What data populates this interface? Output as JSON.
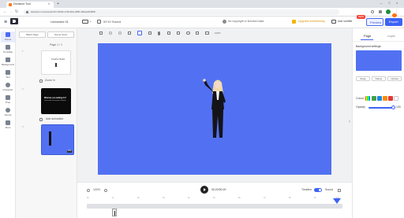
{
  "browser": {
    "tab_title": "Doratoon Tool",
    "url": "doratoon.com/vue/tool?c=2003-cc45-4f2e-9f5b-4f0e2e0b0f68"
  },
  "header": {
    "project_name": "Unnamed 01",
    "scene_count": "00'10 Saved",
    "copyright_notice": "No copyright or licensed data",
    "upgrade_label": "Upgrade membership",
    "add_subtitle_label": "Add subtitle",
    "new_badge": "NEW",
    "preview_label": "Preview",
    "export_label": "Export",
    "export_badge": "!"
  },
  "rail": {
    "items": [
      {
        "label": "Scene",
        "icon": "scene-icon"
      },
      {
        "label": "Template",
        "icon": "template-icon"
      },
      {
        "label": "Background",
        "icon": "background-icon"
      },
      {
        "label": "Text",
        "icon": "text-icon"
      },
      {
        "label": "Character",
        "icon": "character-icon"
      },
      {
        "label": "Prop",
        "icon": "prop-icon"
      },
      {
        "label": "Sound",
        "icon": "sound-icon"
      },
      {
        "label": "More",
        "icon": "more-icon"
      }
    ]
  },
  "scenes_panel": {
    "blank_page_label": "Blank Page",
    "scene store_label": "Scene Store",
    "page_counter": "Page 1 / 1",
    "thumb1_text": "Creative Studio",
    "zoom_label": "Zoom in",
    "thumb2_title": "What are you waiting for?",
    "thumb2_subtitle": "Create video in one minute in Doratoon",
    "add_animation_label": "Add animation",
    "thumb3_time": "10s"
  },
  "toolbar": {
    "zoom_value": "100%"
  },
  "right_panel": {
    "tab_page": "Page",
    "tab_layer": "Layer",
    "bg_settings_label": "Background settings",
    "swap_label": "Swap",
    "delete_label": "Delete",
    "upload_label": "Upload",
    "colour_label": "Colour",
    "opacity_label": "Opacity",
    "opacity_value": "100",
    "swatch_colors": [
      "#e53935",
      "#43a047",
      "#1e88e5",
      "#fb8c00",
      "#e53935",
      "#ffffff"
    ],
    "canvas_color": "#5271f2"
  },
  "timeline": {
    "zoom_label": "100%",
    "timecode": "00:22/00:20",
    "timeline_label": "Timeline",
    "sound_label": "Sound",
    "ticks": [
      "0s",
      "1s",
      "2s",
      "3s",
      "4s",
      "5s",
      "6s",
      "7s",
      "8s",
      "9s",
      "10s"
    ]
  }
}
